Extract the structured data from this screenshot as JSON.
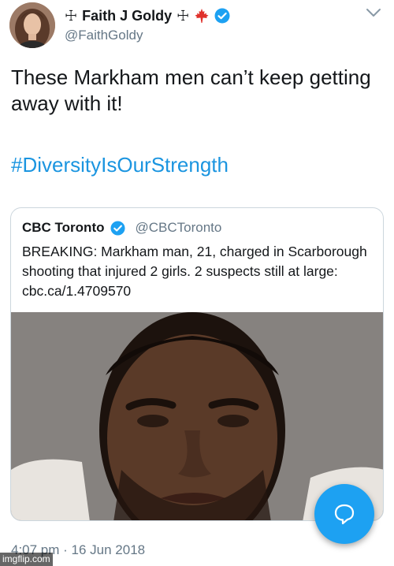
{
  "author": {
    "cross_left": "☩",
    "display_name": "Faith J Goldy",
    "cross_right": "☩",
    "handle": "@FaithGoldy",
    "verified_icon": "verified-badge-icon",
    "flag_icon": "maple-leaf-icon"
  },
  "tweet": {
    "text": "These Markham men can’t keep getting away with it!",
    "hashtag": "#DiversityIsOurStrength",
    "timestamp": "4:07 pm · 16 Jun 2018"
  },
  "quoted_tweet": {
    "display_name": "CBC Toronto",
    "handle": "@CBCToronto",
    "text": "BREAKING: Markham man, 21, charged in Scarborough shooting that injured 2 girls. 2 suspects still at large: cbc.ca/1.4709570"
  },
  "watermark": "imgflip.com",
  "colors": {
    "link": "#1b95e0",
    "secondary_text": "#657786",
    "verified": "#1da1f2",
    "flag": "#e0312c",
    "fab": "#1da1f2"
  }
}
